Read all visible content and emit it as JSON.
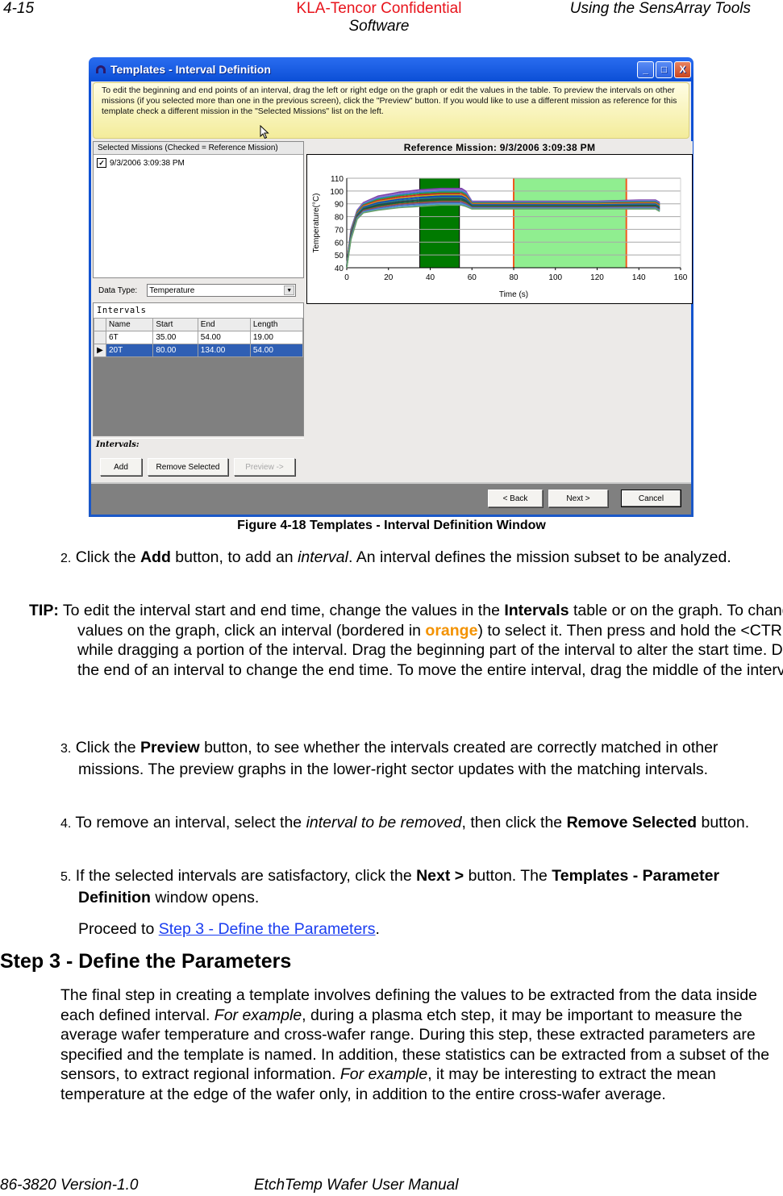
{
  "page_header": {
    "page_number": "4-15",
    "confidential": "KLA-Tencor Confidential",
    "section_line2": "Software",
    "chapter": "Using the SensArray Tools"
  },
  "window": {
    "title": "Templates - Interval Definition",
    "controls": {
      "minimize": "_",
      "maximize": "□",
      "close": "X"
    },
    "help_text": "To edit the beginning and end points of an interval, drag the left or right edge on the graph or edit the values in the table.  To preview the intervals on other missions (if you selected more than one in the previous screen), click the \"Preview\" button.  If you would like to use a different mission as reference for this template check a different mission in the \"Selected Missions\" list on the left.",
    "missions": {
      "header": "Selected Missions (Checked = Reference Mission)",
      "items": [
        {
          "label": "9/3/2006 3:09:38 PM",
          "checked": true
        }
      ]
    },
    "data_type": {
      "label": "Data Type:",
      "value": "Temperature"
    },
    "intervals_table": {
      "title": "Intervals",
      "columns": [
        "Name",
        "Start",
        "End",
        "Length"
      ],
      "rows": [
        {
          "name": "6T",
          "start": "35.00",
          "end": "54.00",
          "length": "19.00",
          "selected": false
        },
        {
          "name": "20T",
          "start": "80.00",
          "end": "134.00",
          "length": "54.00",
          "selected": true
        }
      ]
    },
    "interval_actions": {
      "label": "Intervals:",
      "add": "Add",
      "remove": "Remove Selected",
      "preview": "Preview ->"
    },
    "nav": {
      "back": "< Back",
      "next": "Next >",
      "cancel": "Cancel"
    },
    "chart_title": "Reference Mission: 9/3/2006 3:09:38 PM"
  },
  "chart_data": {
    "type": "line",
    "title": "Reference Mission: 9/3/2006 3:09:38 PM",
    "xlabel": "Time (s)",
    "ylabel": "Temperature(°C)",
    "xlim": [
      0,
      160
    ],
    "ylim": [
      40,
      110
    ],
    "xticks": [
      0,
      20,
      40,
      60,
      80,
      100,
      120,
      140,
      160
    ],
    "yticks": [
      40,
      50,
      60,
      70,
      80,
      90,
      100,
      110
    ],
    "grid": "horizontal",
    "series_note": "many sensor traces (multi-colored) ramping from ~40°C to ~85–100°C by 35 s, dropping at ~56 s to ~87–92°C, ending at ~150 s",
    "series_envelope": {
      "x": [
        0,
        2,
        5,
        8,
        15,
        25,
        35,
        45,
        55,
        57,
        60,
        80,
        100,
        120,
        140,
        148,
        150
      ],
      "upper": [
        42,
        70,
        85,
        91,
        96,
        99,
        101,
        102,
        102,
        100,
        92,
        92,
        92,
        92,
        93,
        93,
        91
      ],
      "lower": [
        40,
        62,
        78,
        83,
        85,
        87,
        88,
        89,
        89,
        88,
        86,
        86,
        86,
        86,
        86,
        86,
        84
      ]
    },
    "intervals": [
      {
        "name": "6T",
        "start": 35,
        "end": 54,
        "color": "#007a00",
        "selected": false
      },
      {
        "name": "20T",
        "start": 80,
        "end": 134,
        "color": "#90ee90",
        "border": "#f05a1e",
        "selected": true
      }
    ]
  },
  "document": {
    "figure_caption": "Figure 4-18 Templates - Interval Definition Window",
    "step2": {
      "num": "2.",
      "t1": " Click the ",
      "b1": "Add",
      "t2": " button, to add an ",
      "i1": "interval",
      "t3": ". An interval defines the mission subset to be analyzed."
    },
    "tip": {
      "label": "TIP:",
      "t1": " To edit the interval start and end time, change the values in the ",
      "b1": "Intervals",
      "t2": " table or on the graph. To change the values on the graph, click an interval (bordered in ",
      "orange": "orange",
      "t3": ") to select it. Then press and hold the <CTRL> key while dragging a portion of the interval. Drag the beginning part of the interval to alter the start time. Drag the end of an interval to change the end time. To move the entire interval, drag the middle of the interval."
    },
    "step3": {
      "num": "3.",
      "t1": " Click the ",
      "b1": "Preview",
      "t2": " button, to see whether the intervals created are correctly matched in other missions. The preview graphs in the lower-right sector updates with the matching intervals."
    },
    "step4": {
      "num": "4.",
      "t1": " To remove an interval, select the ",
      "i1": "interval to be removed",
      "t2": ", then click the ",
      "b1": "Remove Selected",
      "t3": " button."
    },
    "step5": {
      "num": "5.",
      "t1": " If the selected intervals are satisfactory, click the ",
      "b1": "Next >",
      "t2": " button. The ",
      "b2": "Templates - Parameter Definition",
      "t3": " window opens."
    },
    "proceed": {
      "t1": "Proceed to ",
      "link": "Step 3 - Define the Parameters",
      "t2": "."
    },
    "heading": "Step 3 - Define the Parameters",
    "final_para": {
      "t1": "The final step in creating a template involves defining the values to be extracted from the data inside each defined interval. ",
      "i1": "For example",
      "t2": ", during a plasma etch step, it may be important to measure the average wafer temperature and cross-wafer range. During this step, these extracted parameters are specified and the template is named. In addition, these statistics can be extracted from a subset of the sensors, to extract regional information. ",
      "i2": "For example",
      "t3": ", it may be interesting to extract the mean temperature at the edge of the wafer only, in addition to the entire cross-wafer average."
    }
  },
  "page_footer": {
    "doc_number": "86-3820 Version-1.0",
    "manual": "EtchTemp Wafer User Manual"
  }
}
